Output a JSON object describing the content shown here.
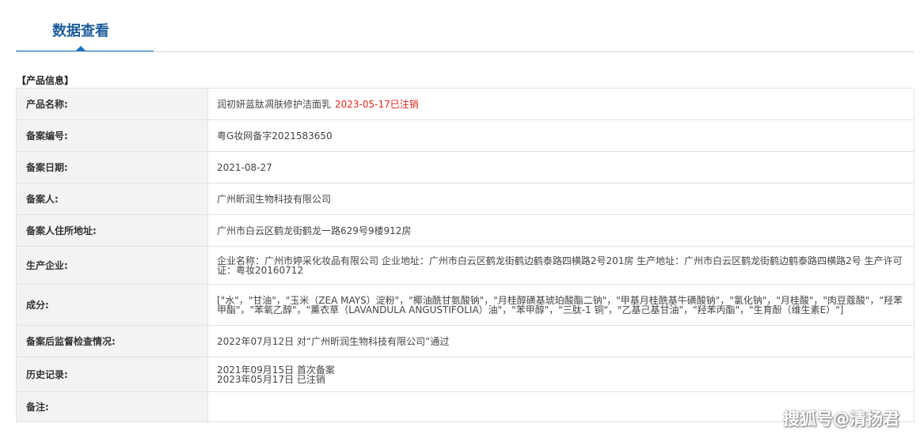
{
  "tabs": {
    "active_label": "数据查看"
  },
  "section": {
    "title": "【产品信息】"
  },
  "rows": {
    "product_name": {
      "label": "产品名称:",
      "value": "润初妍蓝肽凋肤修护洁面乳",
      "status": "2023-05-17已注销"
    },
    "record_number": {
      "label": "备案编号:",
      "value": "粤G妆网备字2021583650"
    },
    "record_date": {
      "label": "备案日期:",
      "value": "2021-08-27"
    },
    "registrant": {
      "label": "备案人:",
      "value": "广州昕润生物科技有限公司"
    },
    "registrant_address": {
      "label": "备案人住所地址:",
      "value": "广州市白云区鹤龙街鹤龙一路629号9楼912房"
    },
    "manufacturer": {
      "label": "生产企业:",
      "value": "企业名称：广州市婷采化妆品有限公司 企业地址：广州市白云区鹤龙街鹤边鹤泰路四横路2号201房 生产地址：广州市白云区鹤龙街鹤边鹤泰路四横路2号 生产许可证：粤妆20160712"
    },
    "ingredients": {
      "label": "成分:",
      "value": "[\"水\"，\"甘油\"，\"玉米（ZEA MAYS）淀粉\"，\"椰油酰甘氨酸钠\"，\"月桂醇磺基琥珀酸酯二钠\"，\"甲基月桂酰基牛磺酸钠\"，\"氯化钠\"，\"月桂酸\"，\"肉豆蔻酸\"，\"羟苯甲酯\"，\"苯氧乙醇\"，\"薰衣草（LAVANDULA ANGUSTIFOLIA）油\"，\"苯甲醇\"，\"三肽-1 铜\"，\"乙基己基甘油\"，\"羟苯丙酯\"，\"生育酚（维生素E）\"]"
    },
    "inspection": {
      "label": "备案后监督检查情况:",
      "value": "2022年07月12日 对“广州昕润生物科技有限公司”通过"
    },
    "history": {
      "label": "历史记录:",
      "value": "2021年09月15日 首次备案\n2023年05月17日 已注销"
    },
    "remarks": {
      "label": "备注:",
      "value": ""
    }
  },
  "watermark": "搜狐号@清扬君"
}
